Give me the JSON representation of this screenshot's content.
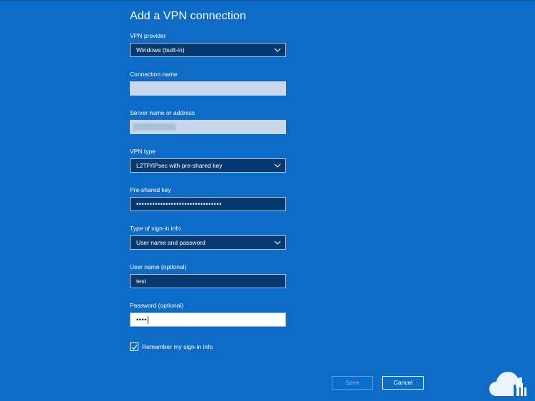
{
  "dialog": {
    "title": "Add a VPN connection"
  },
  "fields": {
    "vpn_provider": {
      "label": "VPN provider",
      "value": "Windows (built-in)"
    },
    "connection_name": {
      "label": "Connection name",
      "value": ""
    },
    "server_name": {
      "label": "Server name or address",
      "value": ""
    },
    "vpn_type": {
      "label": "VPN type",
      "value": "L2TP/IPsec with pre-shared key"
    },
    "pre_shared_key": {
      "label": "Pre-shared key",
      "value": "••••••••••••••••••••••••••••••••"
    },
    "sign_in_type": {
      "label": "Type of sign-in info",
      "value": "User name and password"
    },
    "user_name": {
      "label": "User name (optional)",
      "value": "test"
    },
    "password": {
      "label": "Password (optional)",
      "value": "••••"
    }
  },
  "remember": {
    "label": "Remember my sign-in info",
    "checked": true
  },
  "buttons": {
    "save": "Save",
    "cancel": "Cancel"
  },
  "colors": {
    "background": "#0c6cc7",
    "field_dark": "#063a70",
    "field_light": "#c8d8ea"
  },
  "icons": {
    "dropdown": "chevron-down-icon",
    "checkbox": "checkmark-icon",
    "watermark": "cloud-logo"
  }
}
